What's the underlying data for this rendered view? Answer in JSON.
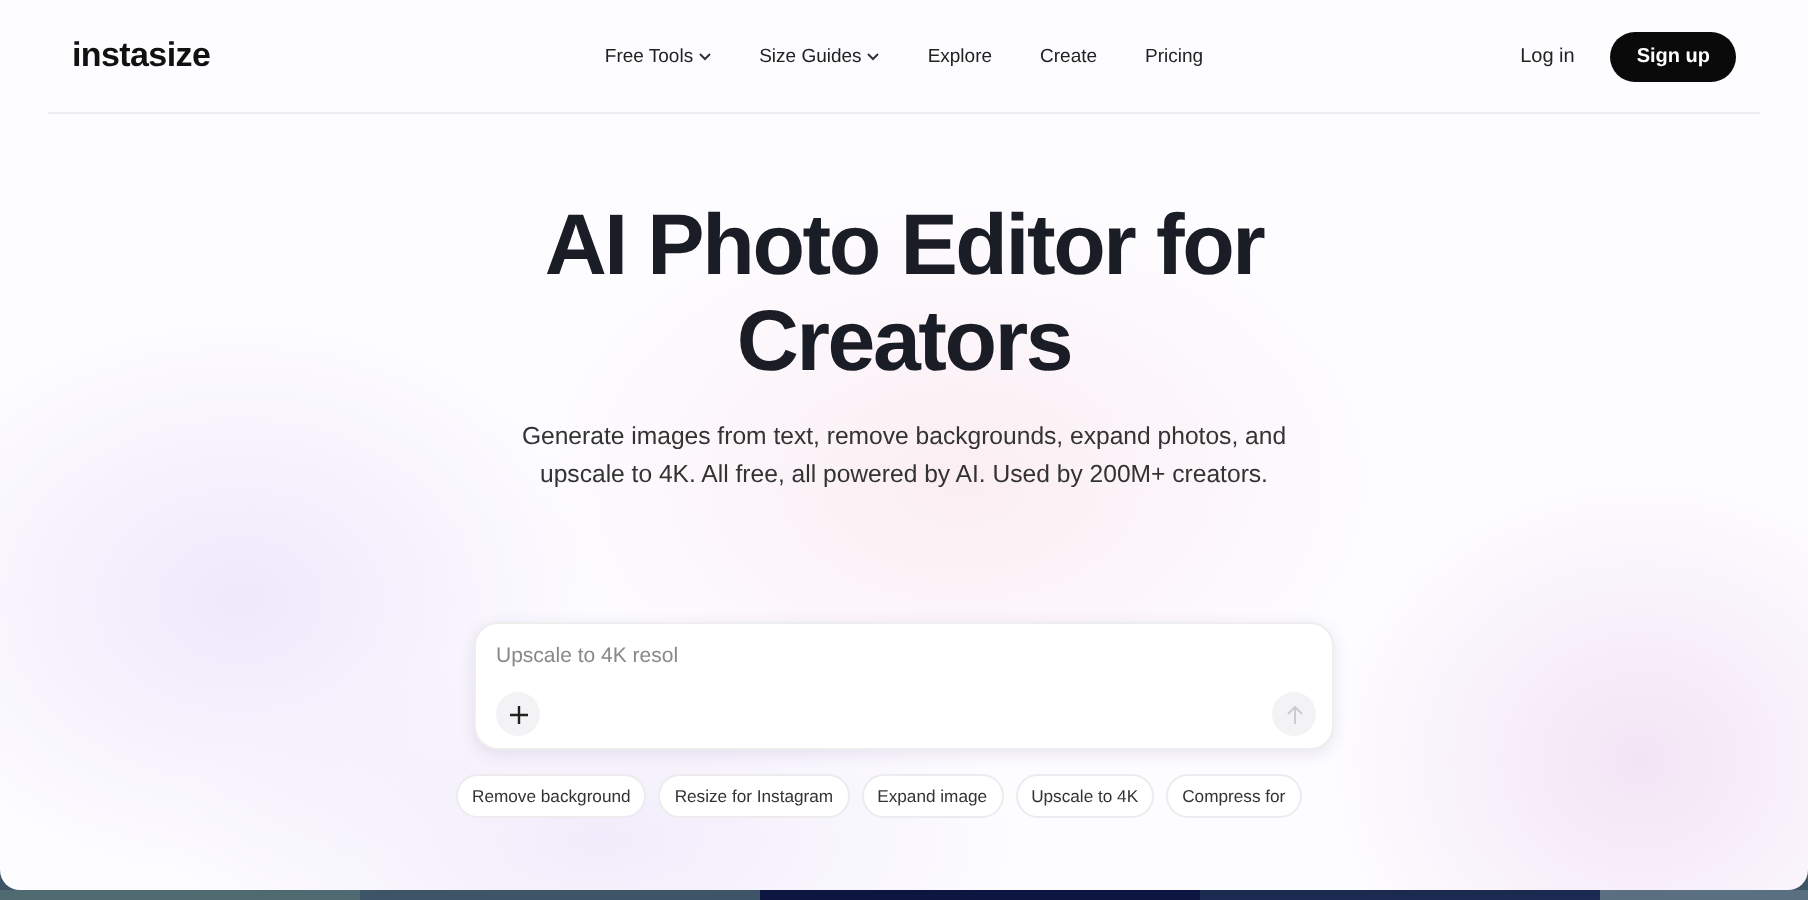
{
  "header": {
    "logo": "instasize",
    "nav": [
      {
        "label": "Free Tools",
        "dropdown": true
      },
      {
        "label": "Size Guides",
        "dropdown": true
      },
      {
        "label": "Explore",
        "dropdown": false
      },
      {
        "label": "Create",
        "dropdown": false
      },
      {
        "label": "Pricing",
        "dropdown": false
      }
    ],
    "login": "Log in",
    "signup": "Sign up"
  },
  "hero": {
    "title_lines": [
      "AI Photo Editor for",
      "Creators"
    ],
    "subtitle_lines": [
      "Generate images from text, remove backgrounds, expand photos, and",
      "upscale to 4K. All free, all powered by AI. Used by 200M+ creators."
    ]
  },
  "prompt": {
    "placeholder": "Upscale to 4K resol"
  },
  "chips": [
    "Remove background",
    "Resize for Instagram",
    "Expand image",
    "Upscale to 4K",
    "Compress for"
  ]
}
